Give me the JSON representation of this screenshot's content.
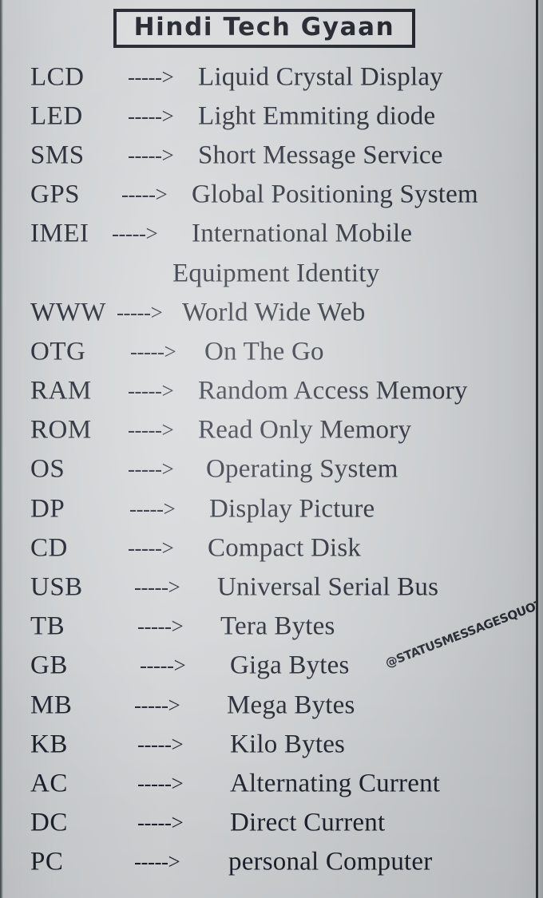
{
  "poster": {
    "title": "Hindi Tech Gyaan",
    "watermark": "@STATUSMESSAGESQUOTES",
    "arrow_glyph": "----->",
    "colors": {
      "background": "#cccfd1",
      "text": "#1b202b",
      "title_border": "#14181f",
      "edge_dark": "#222a2e"
    }
  },
  "entries": [
    {
      "abbr": "LCD",
      "expansion": "Liquid Crystal Display"
    },
    {
      "abbr": "LED",
      "expansion": "Light Emmiting diode"
    },
    {
      "abbr": "SMS",
      "expansion": "Short Message Service"
    },
    {
      "abbr": "GPS",
      "expansion": "Global Positioning System"
    },
    {
      "abbr": "IMEI",
      "expansion": "International Mobile",
      "continuation": "Equipment Identity"
    },
    {
      "abbr": "WWW",
      "expansion": "World Wide Web"
    },
    {
      "abbr": "OTG",
      "expansion": "On The Go"
    },
    {
      "abbr": "RAM",
      "expansion": "Random Access Memory"
    },
    {
      "abbr": "ROM",
      "expansion": "Read Only Memory"
    },
    {
      "abbr": "OS",
      "expansion": "Operating System"
    },
    {
      "abbr": "DP",
      "expansion": "Display Picture"
    },
    {
      "abbr": "CD",
      "expansion": "Compact Disk"
    },
    {
      "abbr": "USB",
      "expansion": "Universal Serial Bus"
    },
    {
      "abbr": "TB",
      "expansion": "Tera Bytes"
    },
    {
      "abbr": "GB",
      "expansion": "Giga Bytes"
    },
    {
      "abbr": "MB",
      "expansion": "Mega Bytes"
    },
    {
      "abbr": "KB",
      "expansion": "Kilo Bytes"
    },
    {
      "abbr": "AC",
      "expansion": "Alternating Current"
    },
    {
      "abbr": "DC",
      "expansion": "Direct Current"
    },
    {
      "abbr": "PC",
      "expansion": "personal Computer"
    }
  ]
}
